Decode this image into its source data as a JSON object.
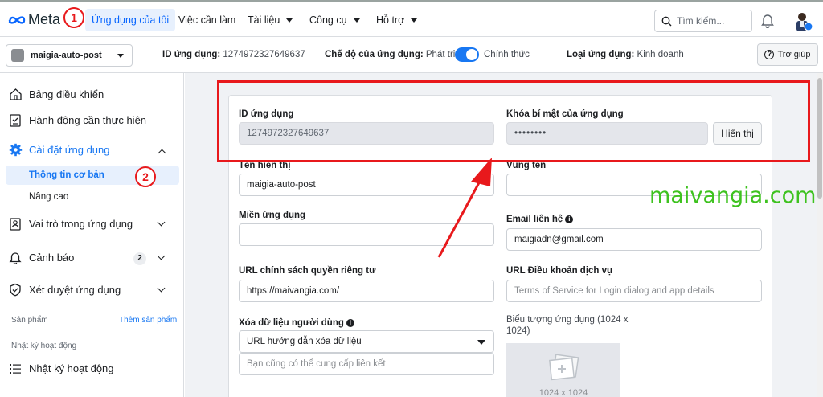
{
  "topnav": {
    "logo": "Meta",
    "items": [
      "Ứng dụng của tôi",
      "Việc cần làm",
      "Tài liệu",
      "Công cụ",
      "Hỗ trợ"
    ],
    "search_placeholder": "Tìm kiếm..."
  },
  "subbar": {
    "app_name": "maigia-auto-post",
    "app_id_label": "ID ứng dụng:",
    "app_id_value": "1274972327649637",
    "mode_label": "Chế độ của ứng dụng:",
    "mode_dev": "Phát triển",
    "mode_live": "Chính thức",
    "type_label": "Loại ứng dụng:",
    "type_value": "Kinh doanh",
    "help": "Trợ giúp"
  },
  "sidebar": {
    "dashboard": "Bảng điều khiển",
    "actions": "Hành động cần thực hiện",
    "settings": "Cài đặt ứng dụng",
    "basic": "Thông tin cơ bản",
    "advanced": "Nâng cao",
    "roles": "Vai trò trong ứng dụng",
    "alerts": "Cảnh báo",
    "alerts_count": "2",
    "review": "Xét duyệt ứng dụng",
    "products": "Sản phẩm",
    "add_product": "Thêm sản phẩm",
    "activity_section": "Nhật ký hoạt động",
    "activity": "Nhật ký hoạt động"
  },
  "form": {
    "app_id_label": "ID ứng dụng",
    "app_id_value": "1274972327649637",
    "secret_label": "Khóa bí mật của ứng dụng",
    "secret_value": "••••••••",
    "show_button": "Hiển thị",
    "display_name_label": "Tên hiển thị",
    "display_name_value": "maigia-auto-post",
    "namespace_label": "Vùng tên",
    "namespace_value": "",
    "domain_label": "Miền ứng dụng",
    "domain_value": "",
    "contact_label": "Email liên hệ",
    "contact_value": "maigiadn@gmail.com",
    "privacy_label": "URL chính sách quyền riêng tư",
    "privacy_value": "https://maivangia.com/",
    "tos_label": "URL Điều khoản dịch vụ",
    "tos_placeholder": "Terms of Service for Login dialog and app details",
    "deletion_label": "Xóa dữ liệu người dùng",
    "deletion_select": "URL hướng dẫn xóa dữ liệu",
    "deletion_placeholder": "Bạn cũng có thể cung cấp liên kết",
    "icon_label": "Biểu tượng ứng dụng (1024 x 1024)",
    "icon_caption": "1024 x 1024"
  },
  "annotations": {
    "step1": "1",
    "step2": "2",
    "watermark": "maivangia.com",
    "color": "#e8191c"
  }
}
